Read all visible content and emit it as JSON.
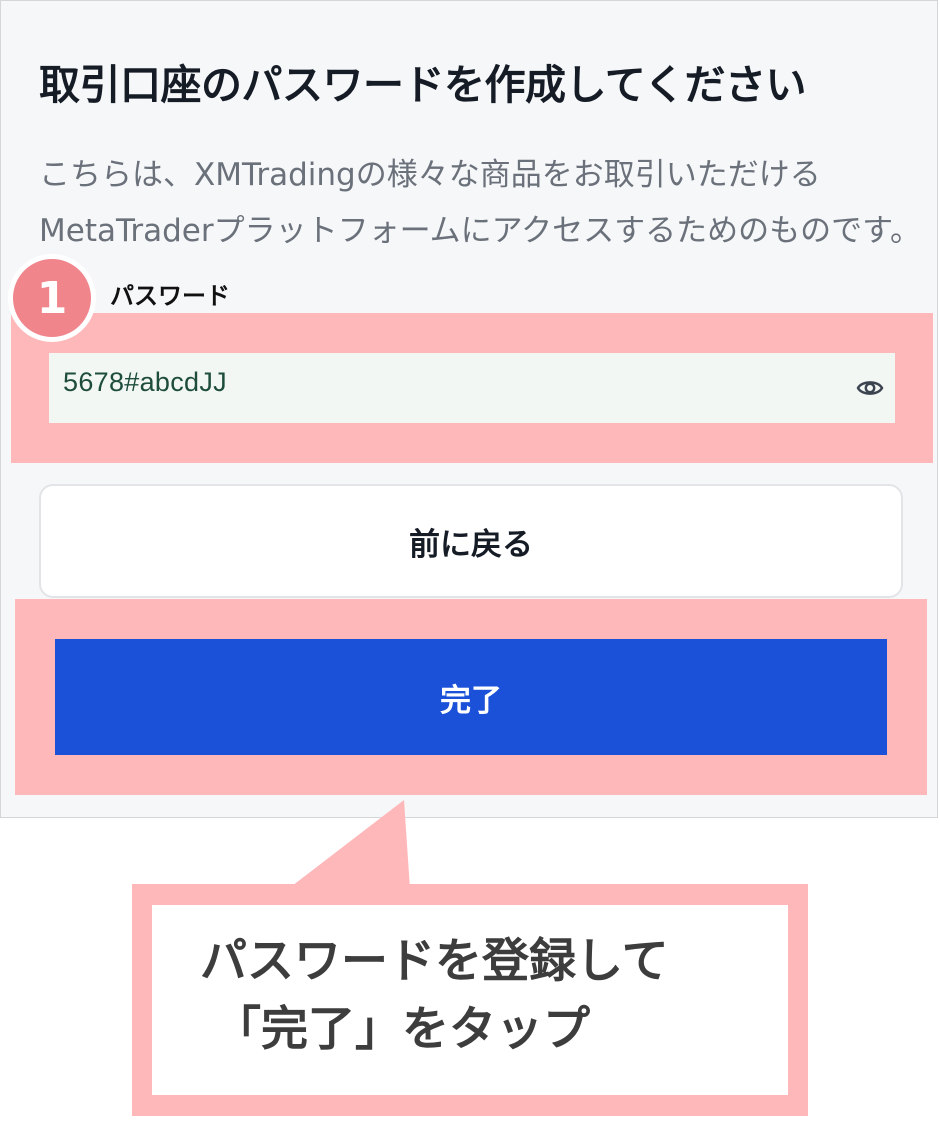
{
  "page": {
    "title": "取引口座のパスワードを作成してください",
    "description_lines": [
      "こちらは、XMTradingの様々な商品をお取引いただける",
      "MetaTraderプラットフォームにアクセスするためのものです。"
    ]
  },
  "password_field": {
    "step_number": "1",
    "label": "パスワード",
    "value": "5678#abcdJJ",
    "toggle_icon": "eye-icon"
  },
  "buttons": {
    "back_label": "前に戻る",
    "complete_label": "完了"
  },
  "callout": {
    "lines": [
      "パスワードを登録して",
      "「完了」をタップ"
    ]
  },
  "colors": {
    "highlight": "#ffb8ba",
    "badge": "#f0858c",
    "primary_button": "#1b51d9",
    "page_background": "#f6f7f9"
  }
}
